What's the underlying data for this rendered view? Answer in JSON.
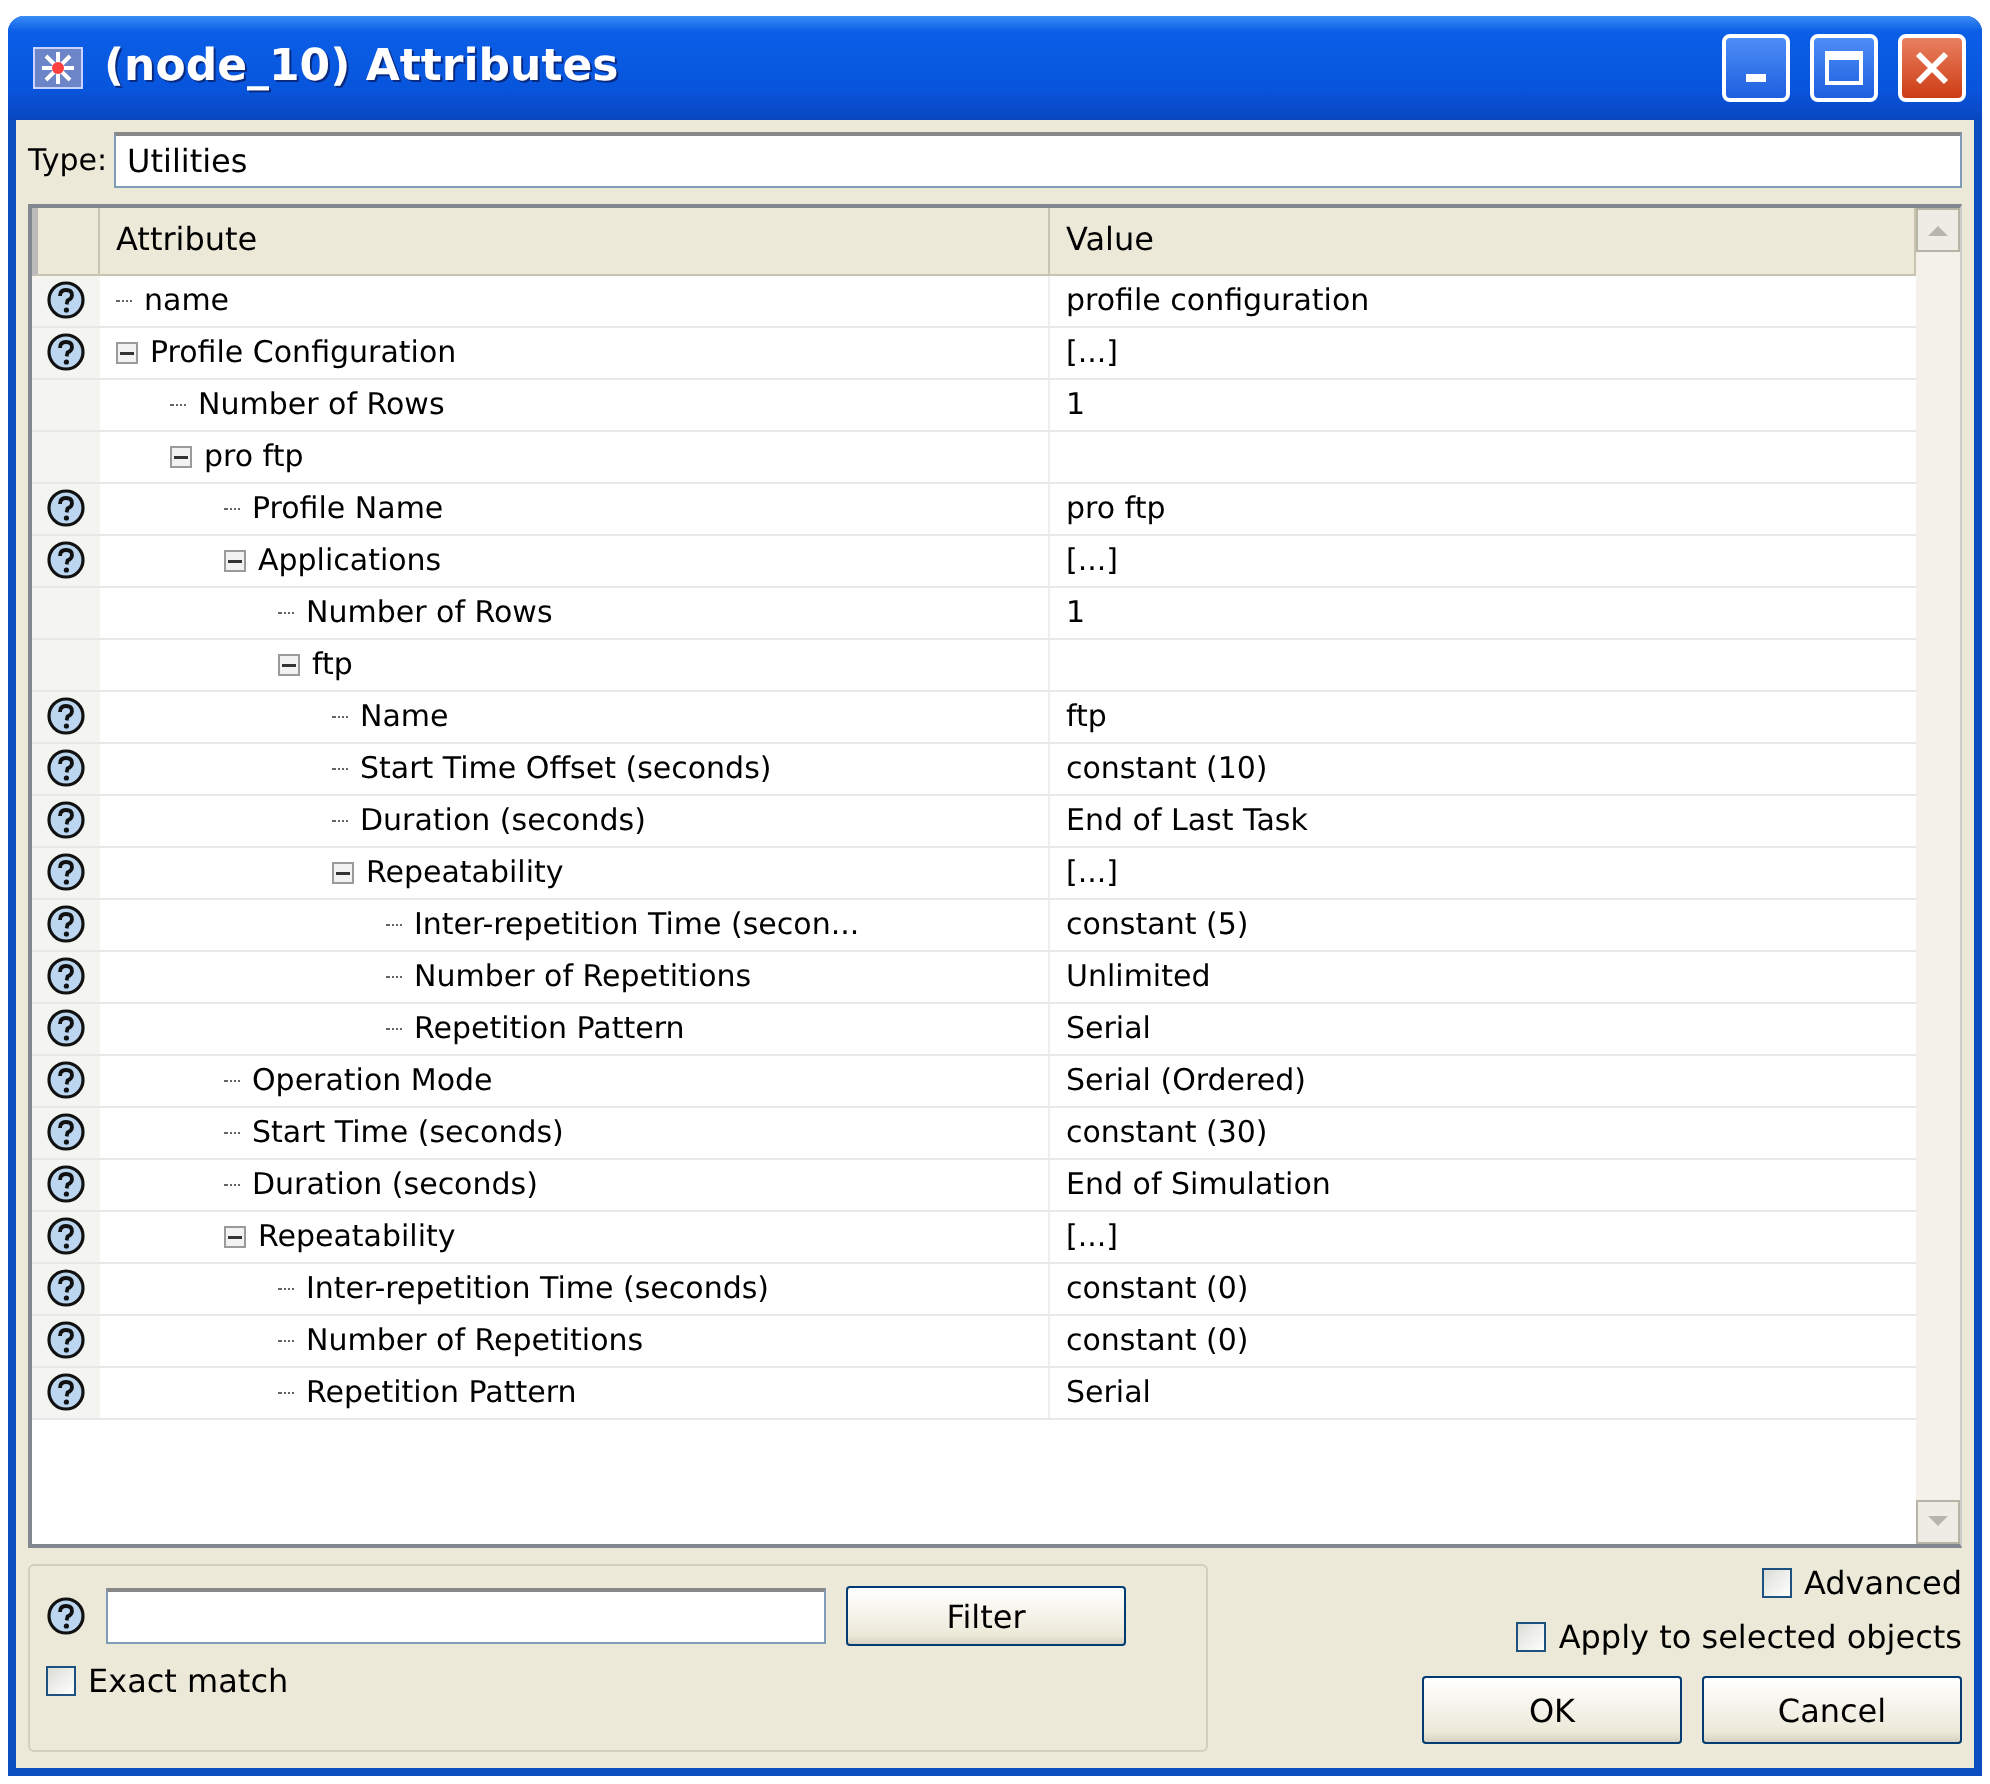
{
  "window": {
    "title": "(node_10) Attributes"
  },
  "type": {
    "label": "Type:",
    "value": "Utilities"
  },
  "table": {
    "columns": [
      "Attribute",
      "Value"
    ],
    "rows": [
      {
        "label": "name",
        "value": "profile configuration",
        "help": true
      },
      {
        "label": "Profile Configuration",
        "value": "[...]",
        "help": true,
        "expanded": true,
        "children": [
          {
            "label": "Number of Rows",
            "value": "1",
            "help": false
          },
          {
            "label": "pro ftp",
            "help": false,
            "expanded": true,
            "children": [
              {
                "label": "Profile Name",
                "value": "pro ftp",
                "help": true
              },
              {
                "label": "Applications",
                "value": "[...]",
                "help": true,
                "expanded": true,
                "children": [
                  {
                    "label": "Number of Rows",
                    "value": "1",
                    "help": false
                  },
                  {
                    "label": "ftp",
                    "help": false,
                    "expanded": true,
                    "children": [
                      {
                        "label": "Name",
                        "value": "ftp",
                        "help": true
                      },
                      {
                        "label": "Start Time Offset (seconds)",
                        "value": "constant (10)",
                        "help": true
                      },
                      {
                        "label": "Duration (seconds)",
                        "value": "End of Last Task",
                        "help": true
                      },
                      {
                        "label": "Repeatability",
                        "value": "[...]",
                        "help": true,
                        "expanded": true,
                        "children": [
                          {
                            "label": "Inter-repetition Time (secon...",
                            "value": "constant (5)",
                            "help": true
                          },
                          {
                            "label": "Number of Repetitions",
                            "value": "Unlimited",
                            "help": true
                          },
                          {
                            "label": "Repetition Pattern",
                            "value": "Serial",
                            "help": true
                          }
                        ]
                      }
                    ]
                  }
                ]
              },
              {
                "label": "Operation Mode",
                "value": "Serial (Ordered)",
                "help": true
              },
              {
                "label": "Start Time (seconds)",
                "value": "constant (30)",
                "help": true
              },
              {
                "label": "Duration (seconds)",
                "value": "End of Simulation",
                "help": true
              },
              {
                "label": "Repeatability",
                "value": "[...]",
                "help": true,
                "expanded": true,
                "children": [
                  {
                    "label": "Inter-repetition Time (seconds)",
                    "value": "constant (0)",
                    "help": true
                  },
                  {
                    "label": "Number of Repetitions",
                    "value": "constant (0)",
                    "help": true
                  },
                  {
                    "label": "Repetition Pattern",
                    "value": "Serial",
                    "help": true
                  }
                ]
              }
            ]
          }
        ]
      }
    ]
  },
  "filter": {
    "button": "Filter",
    "exact_match": {
      "label": "Exact match",
      "checked": false
    }
  },
  "options": [
    {
      "label": "Advanced",
      "checked": false
    },
    {
      "label": "Apply to selected objects",
      "checked": false
    }
  ],
  "buttons": [
    "OK",
    "Cancel"
  ]
}
